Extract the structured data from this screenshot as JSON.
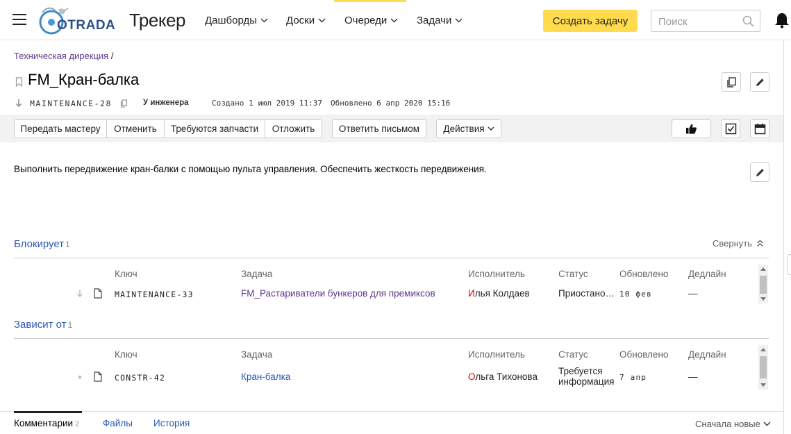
{
  "header": {
    "logo_text": "OTRADA",
    "product_name": "Трекер",
    "nav": [
      {
        "label": "Дашборды"
      },
      {
        "label": "Доски"
      },
      {
        "label": "Очереди"
      },
      {
        "label": "Задачи"
      }
    ],
    "create_button": "Создать задачу",
    "search_placeholder": "Поиск",
    "accent_color": "#ffdb4d"
  },
  "issue": {
    "breadcrumb": "Техническая дирекция",
    "breadcrumb_sep": "/",
    "title": "FM_Кран-балка",
    "key": "MAINTENANCE-28",
    "status": "У инженера",
    "created": "Создано 1 июл 2019 11:37",
    "updated": "Обновлено 6 апр 2020 15:16",
    "description": "Выполнить передвижение кран-балки с помощью пульта управления. Обеспечить жесткость передвижения."
  },
  "toolbar": {
    "transfer": "Передать мастеру",
    "cancel": "Отменить",
    "parts": "Требуются запчасти",
    "postpone": "Отложить",
    "reply_email": "Ответить письмом",
    "actions": "Действия"
  },
  "links": {
    "collapse": "Свернуть",
    "columns": {
      "key": "Ключ",
      "task": "Задача",
      "assignee": "Исполнитель",
      "status": "Статус",
      "updated": "Обновлено",
      "deadline": "Дедлайн"
    },
    "blocks": {
      "title": "Блокирует",
      "count": "1",
      "rows": [
        {
          "key": "MAINTENANCE-33",
          "task": "FM_Растариватели бункеров для премиксов",
          "assignee_initial": "И",
          "assignee_rest": "лья Колдаев",
          "status": "Приостано…",
          "updated": "10 фев",
          "deadline": "—"
        }
      ]
    },
    "depends": {
      "title": "Зависит от",
      "count": "1",
      "rows": [
        {
          "key": "CONSTR-42",
          "task": "Кран-балка",
          "assignee_initial": "О",
          "assignee_rest": "льга Тихонова",
          "status_line1": "Требуется",
          "status_line2": "информация",
          "updated": "7 апр",
          "deadline": "—"
        }
      ]
    }
  },
  "tabs": {
    "comments": "Комментарии",
    "comments_count": "2",
    "files": "Файлы",
    "history": "История",
    "sort": "Сначала новые"
  }
}
